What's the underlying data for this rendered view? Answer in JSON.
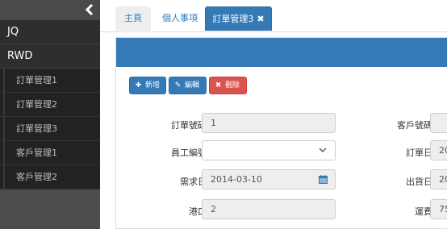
{
  "sidebar": {
    "menus": [
      {
        "label": "JQ"
      },
      {
        "label": "RWD"
      }
    ],
    "items": [
      {
        "label": "訂單管理1"
      },
      {
        "label": "訂單管理2"
      },
      {
        "label": "訂單管理3"
      },
      {
        "label": "客戶管理1"
      },
      {
        "label": "客戶管理2"
      }
    ]
  },
  "tabs": [
    {
      "label": "主頁"
    },
    {
      "label": "個人事項"
    },
    {
      "label": "訂單管理3",
      "close": "✖"
    }
  ],
  "toolbar": {
    "add_icon": "✚",
    "add_label": "新增",
    "edit_icon": "✎",
    "edit_label": "編輯",
    "delete_icon": "✖",
    "delete_label": "刪除"
  },
  "form": {
    "order_no_label": "訂單號碼",
    "order_no_value": "1",
    "customer_no_label": "客戶號碼",
    "customer_no_value": "",
    "employee_no_label": "員工編號",
    "employee_no_value": "",
    "order_date_label": "訂單日",
    "order_date_value": "20",
    "required_date_label": "需求日",
    "required_date_value": "2014-03-10",
    "shipped_date_label": "出貨日",
    "shipped_date_value": "20",
    "port_label": "港口",
    "port_value": "2",
    "freight_label": "運費",
    "freight_value": "75"
  },
  "colors": {
    "primary": "#337ab7",
    "danger": "#d9534f",
    "sidebar": "#4a4a4a"
  }
}
